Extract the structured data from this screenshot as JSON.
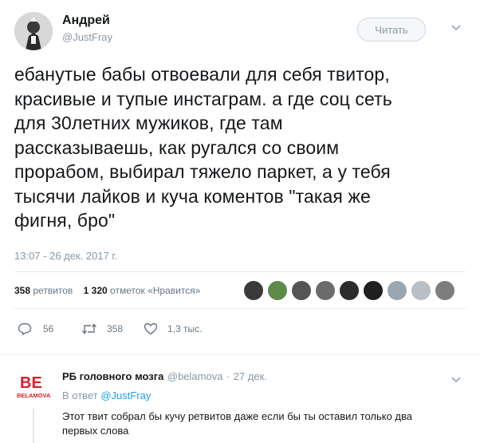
{
  "tweet": {
    "author": {
      "name": "Андрей",
      "handle": "@JustFray"
    },
    "follow_label": "Читать",
    "text_lines": [
      "ебанутые бабы отвоевали для себя твитор,",
      "красивые и тупые инстаграм. а где соц сеть",
      "для 30летних мужиков, где там",
      "рассказываешь, как ругался со своим",
      "прорабом, выбирал тяжело паркет, а у тебя",
      "тысячи лайков и куча коментов \"такая же",
      "фигня, бро\""
    ],
    "timestamp": "13:07 - 26 дек. 2017 г.",
    "stats": {
      "retweets_count": "358",
      "retweets_label": "ретвитов",
      "likes_count": "1 320",
      "likes_label": "отметок «Нравится»"
    },
    "actions": {
      "reply_count": "56",
      "retweet_count": "358",
      "like_count": "1,3 тыс."
    },
    "liker_colors": [
      "#3a3a3a",
      "#5e8a4a",
      "#555555",
      "#6b6b6b",
      "#2c2c2c",
      "#1f1f1f",
      "#9aa7b0",
      "#b8c0c6",
      "#7d7d7d"
    ]
  },
  "reply": {
    "avatar_text_top": "BE",
    "avatar_text_bottom": "BELAMOVA",
    "name": "РБ головного мозга",
    "handle": "@belamova",
    "date": "27 дек.",
    "reply_to_prefix": "В ответ",
    "reply_to_handle": "@JustFray",
    "text_lines": [
      "Этот твит собрал бы кучу ретвитов даже если бы ты оставил только два",
      "первых слова"
    ]
  },
  "colors": {
    "brand_red": "#d9202a",
    "link_blue": "#1da1f2",
    "muted": "#8899a6"
  }
}
